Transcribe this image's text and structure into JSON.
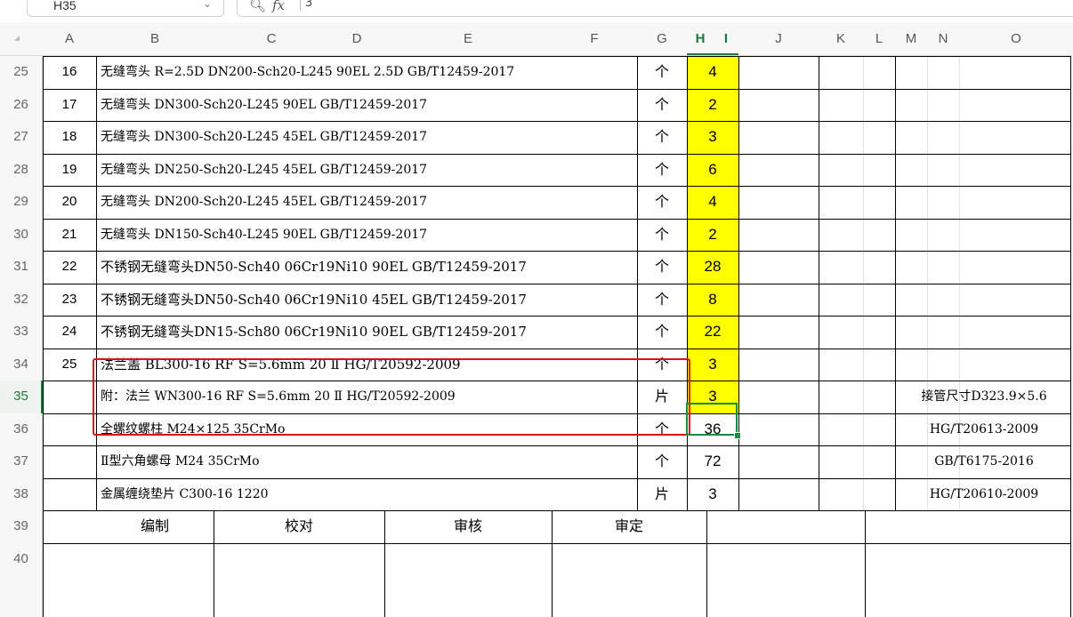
{
  "toolbar": {
    "name_box": "H35",
    "formula_value": "3",
    "zoom_icon": "search-icon",
    "fx_label": "fx"
  },
  "columns": [
    "A",
    "B",
    "C",
    "D",
    "E",
    "F",
    "G",
    "H",
    "I",
    "J",
    "K",
    "L",
    "M",
    "N",
    "O"
  ],
  "rows": [
    {
      "row": "25",
      "seq": "16",
      "desc": "无缝弯头 R=2.5D DN200-Sch20-L245      90EL   2.5D   GB/T12459-2017",
      "unit": "个",
      "qty": "4",
      "remark": ""
    },
    {
      "row": "26",
      "seq": "17",
      "desc": "无缝弯头  DN300-Sch20-L245       90EL     GB/T12459-2017",
      "unit": "个",
      "qty": "2",
      "remark": ""
    },
    {
      "row": "27",
      "seq": "18",
      "desc": "无缝弯头  DN300-Sch20-L245       45EL     GB/T12459-2017",
      "unit": "个",
      "qty": "3",
      "remark": ""
    },
    {
      "row": "28",
      "seq": "19",
      "desc": "无缝弯头  DN250-Sch20-L245       45EL     GB/T12459-2017",
      "unit": "个",
      "qty": "6",
      "remark": ""
    },
    {
      "row": "29",
      "seq": "20",
      "desc": "无缝弯头  DN200-Sch20-L245       45EL     GB/T12459-2017",
      "unit": "个",
      "qty": "4",
      "remark": ""
    },
    {
      "row": "30",
      "seq": "21",
      "desc": "无缝弯头  DN150-Sch40-L245       90EL        GB/T12459-2017",
      "unit": "个",
      "qty": "2",
      "remark": ""
    },
    {
      "row": "31",
      "seq": "22",
      "desc": "不锈钢无缝弯头DN50-Sch40 06Cr19Ni10   90EL   GB/T12459-2017",
      "unit": "个",
      "qty": "28",
      "remark": ""
    },
    {
      "row": "32",
      "seq": "23",
      "desc": "不锈钢无缝弯头DN50-Sch40 06Cr19Ni10   45EL   GB/T12459-2017",
      "unit": "个",
      "qty": "8",
      "remark": ""
    },
    {
      "row": "33",
      "seq": "24",
      "desc": "不锈钢无缝弯头DN15-Sch80 06Cr19Ni10   90EL   GB/T12459-2017",
      "unit": "个",
      "qty": "22",
      "remark": ""
    },
    {
      "row": "34",
      "seq": "25",
      "desc": "法兰盖  BL300-16   RF   S=5.6mm   20 Ⅱ        HG/T20592-2009",
      "unit": "个",
      "qty": "3",
      "remark": ""
    },
    {
      "row": "35",
      "seq": "",
      "desc": "附：法兰    WN300-16   RF   S=5.6mm   20 Ⅱ     HG/T20592-2009",
      "unit": "片",
      "qty": "3",
      "remark": "接管尺寸D323.9×5.6"
    },
    {
      "row": "36",
      "seq": "",
      "desc": "全螺纹螺柱          M24×125         35CrMo",
      "unit": "个",
      "qty": "36",
      "remark": "HG/T20613-2009"
    },
    {
      "row": "37",
      "seq": "",
      "desc": "Ⅱ型六角螺母    M24         35CrMo",
      "unit": "个",
      "qty": "72",
      "remark": "GB/T6175-2016"
    },
    {
      "row": "38",
      "seq": "",
      "desc": "金属缠绕垫片  C300-16      1220",
      "unit": "片",
      "qty": "3",
      "remark": "HG/T20610-2009"
    }
  ],
  "footer": {
    "row39": "39",
    "row40": "40",
    "prepared": "编制",
    "checked": "校对",
    "reviewed": "审核",
    "approved": "审定"
  },
  "colors": {
    "highlight": "#ffff00",
    "selection": "#1a7a3c",
    "annotation_box": "#e0101a"
  }
}
